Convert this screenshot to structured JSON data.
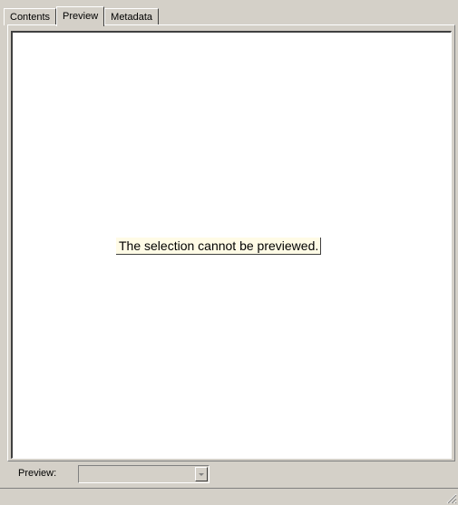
{
  "tabs": [
    {
      "label": "Contents",
      "selected": false
    },
    {
      "label": "Preview",
      "selected": true
    },
    {
      "label": "Metadata",
      "selected": false
    }
  ],
  "preview": {
    "message": "The selection cannot be previewed."
  },
  "bottom_bar": {
    "label": "Preview:",
    "dropdown_value": "",
    "dropdown_icon": "chevron-down-icon"
  },
  "statusbar": {
    "grip_icon": "size-grip-icon"
  }
}
